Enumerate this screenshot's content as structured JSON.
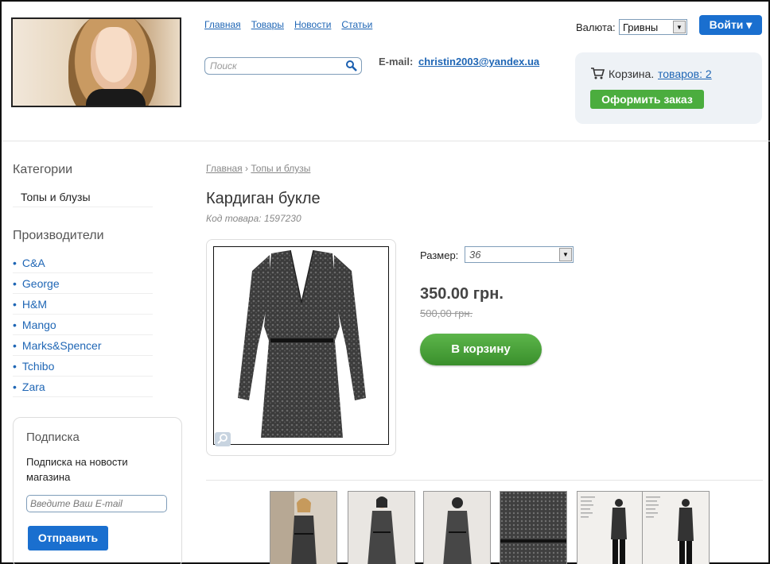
{
  "header": {
    "nav": [
      "Главная",
      "Товары",
      "Новости",
      "Статьи"
    ],
    "search_placeholder": "Поиск",
    "email_label": "E-mail:",
    "email": "christin2003@yandex.ua",
    "currency_label": "Валюта:",
    "currency_value": "Гривны",
    "login_label": "Войти ▾"
  },
  "cart": {
    "label": "Корзина.",
    "items_link": "товаров: 2",
    "checkout_label": "Оформить заказ"
  },
  "sidebar": {
    "categories_title": "Категории",
    "categories": [
      "Топы и блузы"
    ],
    "manufacturers_title": "Производители",
    "manufacturers": [
      "C&A",
      "George",
      "H&M",
      "Mango",
      "Marks&Spencer",
      "Tchibo",
      "Zara"
    ],
    "subscribe": {
      "title": "Подписка",
      "text": "Подписка на новости магазина",
      "placeholder": "Введите Ваш E-mail",
      "button": "Отправить"
    }
  },
  "product": {
    "breadcrumb": [
      "Главная",
      "Топы и блузы"
    ],
    "breadcrumb_sep": "›",
    "title": "Кардиган букле",
    "code": "Код товара: 1597230",
    "size_label": "Размер:",
    "size_value": "36",
    "price": "350.00 грн.",
    "old_price": "500,00 грн.",
    "cart_button": "В корзину"
  },
  "colors": {
    "link": "#1f66b5",
    "primary_button": "#1a6fcf",
    "green_button": "#4bad3e"
  }
}
